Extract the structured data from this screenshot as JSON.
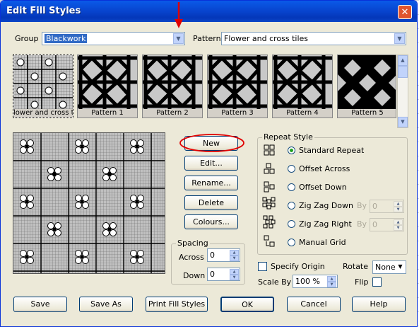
{
  "window": {
    "title": "Edit Fill Styles",
    "close_glyph": "✕"
  },
  "group": {
    "label": "Group",
    "value": "Blackwork"
  },
  "pattern": {
    "label": "Pattern",
    "value": "Flower and cross tiles"
  },
  "thumbnails": [
    {
      "caption": "lower and cross tile"
    },
    {
      "caption": "Pattern 1"
    },
    {
      "caption": "Pattern 2"
    },
    {
      "caption": "Pattern 3"
    },
    {
      "caption": "Pattern 4"
    },
    {
      "caption": "Pattern 5"
    }
  ],
  "actions": {
    "new": "New",
    "edit": "Edit...",
    "rename": "Rename...",
    "delete": "Delete",
    "colours": "Colours..."
  },
  "spacing": {
    "title": "Spacing",
    "across_label": "Across",
    "across_value": "0",
    "down_label": "Down",
    "down_value": "0"
  },
  "repeat_style": {
    "title": "Repeat Style",
    "options": [
      {
        "label": "Standard Repeat",
        "selected": true
      },
      {
        "label": "Offset Across",
        "selected": false
      },
      {
        "label": "Offset Down",
        "selected": false
      },
      {
        "label": "Zig Zag Down",
        "selected": false
      },
      {
        "label": "Zig Zag Right",
        "selected": false
      },
      {
        "label": "Manual Grid",
        "selected": false
      }
    ],
    "by_label": "By",
    "by_value_1": "0",
    "by_value_2": "0"
  },
  "options": {
    "specify_origin": "Specify Origin",
    "rotate_label": "Rotate",
    "rotate_value": "None",
    "scale_label": "Scale By",
    "scale_value": "100 %",
    "flip_label": "Flip"
  },
  "footer": {
    "save": "Save",
    "save_as": "Save As",
    "print": "Print Fill Styles",
    "ok": "OK",
    "cancel": "Cancel",
    "help": "Help"
  },
  "colors": {
    "titlebar": "#0a5ae8",
    "annotation": "#e00000",
    "selection": "#316ac5"
  }
}
